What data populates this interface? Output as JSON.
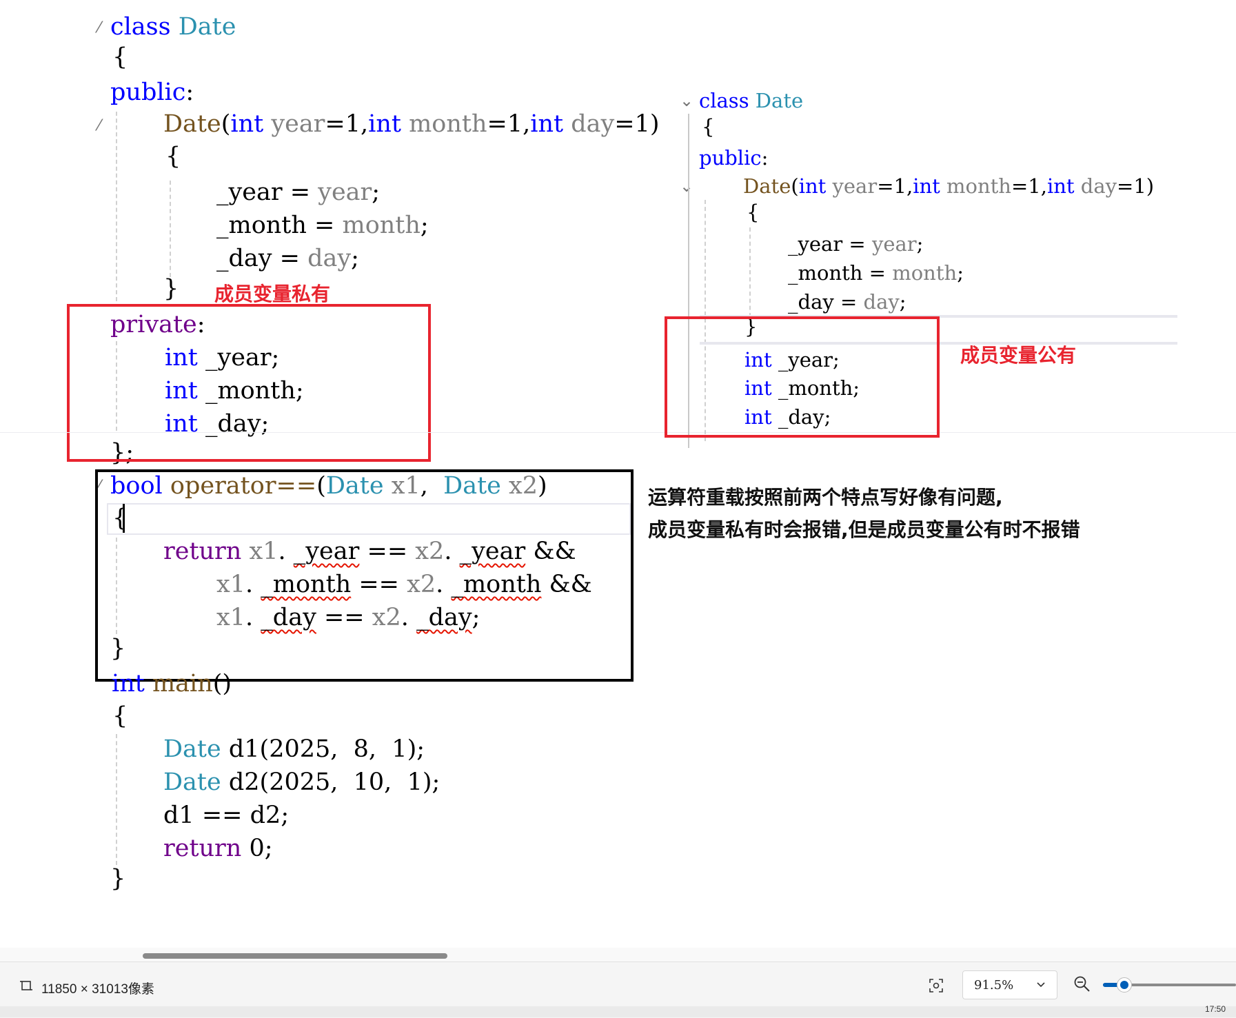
{
  "left_code": {
    "class_kw": "class",
    "class_name": "Date",
    "open_brace": "{",
    "public_kw": "public",
    "colon": ":",
    "ctor_name": "Date",
    "ctor_lparen": "(",
    "int_kw": "int",
    "p_year": "year",
    "p_month": "month",
    "p_day": "day",
    "eq1": "=1,",
    "eq1_last": "=1)",
    "body_open": "{",
    "m_year": "_year",
    "m_month": "_month",
    "m_day": "_day",
    "assign": " = ",
    "semi": ";",
    "body_close": "}",
    "private_kw": "private",
    "class_close": "};"
  },
  "operator_code": {
    "bool_kw": "bool",
    "op_name": "operator==",
    "sig_rest_1": "(",
    "type_date": "Date",
    "x1": "x1",
    "comma": ",",
    "x2": "x2",
    "rparen": ")",
    "open_brace": "{",
    "return_kw": "return",
    "dot": ".",
    "eqeq": "==",
    "and": "&&",
    "close_brace": "}"
  },
  "main_code": {
    "int_kw": "int",
    "main_name": "main",
    "parens": "()",
    "open_brace": "{",
    "type_date": "Date",
    "d1_decl": "d1",
    "d1_args": "(2025,  8,  1);",
    "d2_decl": "d2",
    "d2_args": "(2025,  10,  1);",
    "cmp_line_a": "d1",
    "cmp_op": "==",
    "cmp_line_b": "d2",
    "semi": ";",
    "return_kw": "return",
    "ret_val": "0;",
    "close_brace": "}"
  },
  "right_code": {
    "class_kw": "class",
    "class_name": "Date",
    "open_brace": "{",
    "public_kw": "public",
    "colon": ":",
    "ctor_name": "Date",
    "int_kw": "int",
    "p_year": "year",
    "p_month": "month",
    "p_day": "day",
    "eq1": "=1,",
    "eq1_last": "=1)",
    "lparen": "(",
    "body_open": "{",
    "m_year": "_year",
    "m_month": "_month",
    "m_day": "_day",
    "assign": " = ",
    "semi": ";",
    "body_close": "}",
    "class_close": "};"
  },
  "annotations": {
    "private_note": "成员变量私有",
    "public_note": "成员变量公有",
    "issue_line1": "运算符重载按照前两个特点写好像有问题,",
    "issue_line2": "成员变量私有时会报错,但是成员变量公有时不报错"
  },
  "status_bar": {
    "dimensions": "11850 × 31013像素",
    "zoom_value": "91.5%",
    "zoom_level_percent": 91.5,
    "time_partial": "17:50"
  },
  "icons": {
    "dimensions_icon": "crop-frame-icon",
    "fit_icon": "fit-to-window-icon",
    "dropdown_icon": "chevron-down-icon",
    "zoom_out_icon": "zoom-out-icon"
  },
  "colors": {
    "keyword": "#0000ff",
    "keyword_control": "#6f008a",
    "type": "#2b91af",
    "function": "#74531f",
    "parameter": "#808080",
    "annotation_red": "#e8242f",
    "accent": "#005fb8"
  }
}
